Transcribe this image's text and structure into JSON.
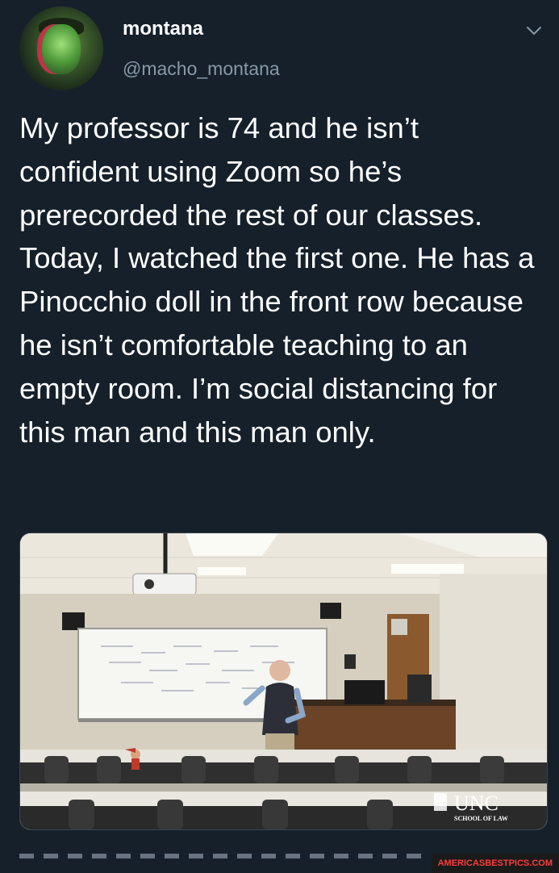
{
  "user": {
    "display_name": "montana",
    "handle": "@macho_montana"
  },
  "tweet": {
    "text": "My professor is 74 and he isn’t confident using Zoom so he’s prerecorded the rest of our classes. Today, I watched the first one. He has a Pinocchio doll in the front row because he isn’t comfortable teaching to an empty room. I’m social distancing for this man and this man only."
  },
  "media": {
    "logo_text": "UNC",
    "logo_subtext": "SCHOOL OF LAW"
  },
  "watermark": "AMERICASBESTPICS.COM",
  "icons": {
    "menu": "chevron-down-icon",
    "avatar": "avatar-image"
  },
  "colors": {
    "background": "#15202b",
    "secondary_text": "#8899a6",
    "watermark": "#ff3c3c"
  }
}
